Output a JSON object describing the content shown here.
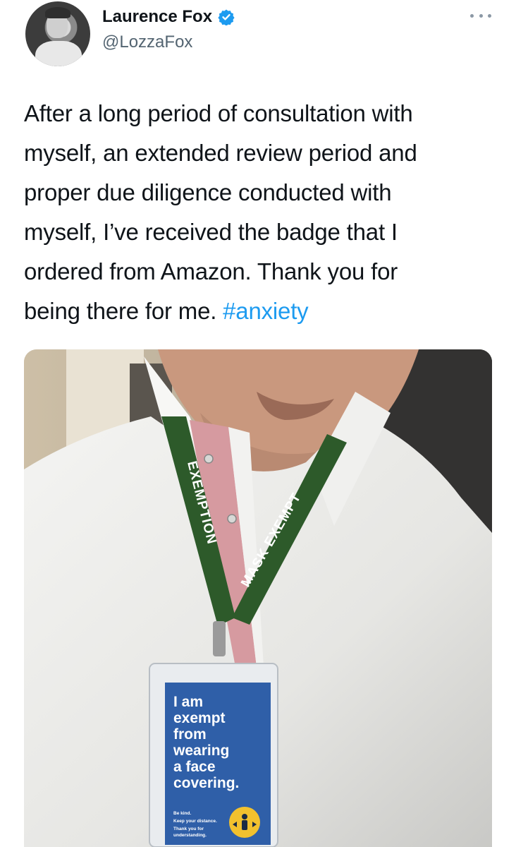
{
  "tweet": {
    "author": {
      "display_name": "Laurence Fox",
      "handle": "@LozzaFox",
      "verified_icon": "verified-badge-icon",
      "avatar_icon": "avatar"
    },
    "more_icon": "more-options-icon",
    "text_lines": [
      "After a long period of consultation with",
      "myself, an extended review period and",
      "proper due diligence conducted with",
      "myself, I’ve received the badge that I",
      "ordered from Amazon. Thank you for",
      "being there for me. "
    ],
    "hashtag": "#anxiety",
    "colors": {
      "link": "#1d9bf0",
      "verified": "#1d9bf0",
      "text": "#0f1419",
      "secondary": "#536471"
    },
    "photo": {
      "lanyard_left": "EXEMPTION",
      "lanyard_right": "MASK EXEMPT",
      "badge_main": [
        "I am",
        "exempt",
        "from",
        "wearing",
        "a face",
        "covering."
      ],
      "badge_small": [
        "Be kind.",
        "Keep your distance.",
        "Thank you for",
        "understanding."
      ]
    }
  }
}
